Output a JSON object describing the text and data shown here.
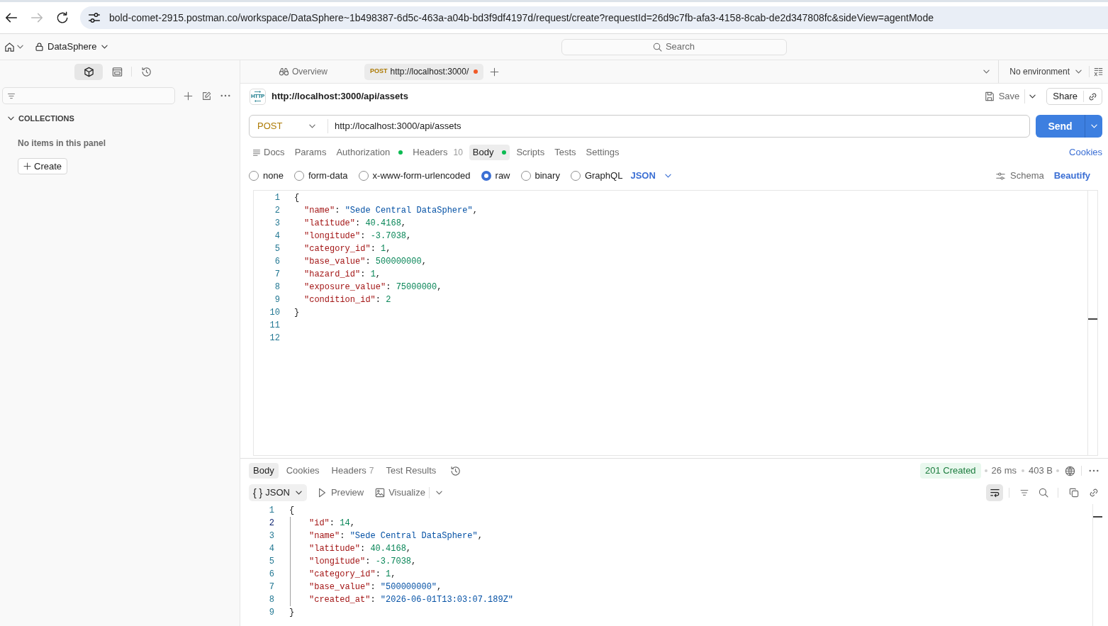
{
  "browser": {
    "back_enabled": true,
    "forward_enabled": false,
    "url": "bold-comet-2915.postman.co/workspace/DataSphere~1b498387-6d5c-463a-a04b-bd3f9df4197d/request/create?requestId=26d9c7fb-afa3-4158-8cab-de2d347808fc&sideView=agentMode"
  },
  "header": {
    "workspace": "DataSphere",
    "search": {
      "placeholder": "Search"
    }
  },
  "sidebar": {
    "views": [
      {
        "kind": "collections",
        "selected": true
      },
      {
        "kind": "panel",
        "selected": false
      },
      {
        "kind": "history",
        "selected": false
      }
    ],
    "section": {
      "title": "COLLECTIONS",
      "expanded": true
    },
    "empty_message": "No items in this panel",
    "create_button": "Create"
  },
  "tabs": [
    {
      "kind": "overview",
      "label": "Overview",
      "selected": false,
      "unsaved": false
    },
    {
      "kind": "request",
      "method": "POST",
      "label": "http://localhost:3000/",
      "selected": true,
      "unsaved": true
    }
  ],
  "environment": "No environment",
  "request": {
    "icon_label": "HTTP",
    "name": "http://localhost:3000/api/assets",
    "save_label": "Save",
    "share_label": "Share",
    "method": "POST",
    "url": "http://localhost:3000/api/assets",
    "send_label": "Send",
    "tabs": [
      {
        "kind": "docs",
        "label": "Docs",
        "dot": false,
        "selected": false
      },
      {
        "kind": "tab",
        "label": "Params",
        "dot": false,
        "selected": false
      },
      {
        "kind": "tab",
        "label": "Authorization",
        "dot": true,
        "selected": false
      },
      {
        "kind": "tab",
        "label": "Headers",
        "count": "10",
        "dot": false,
        "selected": false
      },
      {
        "kind": "tab",
        "label": "Body",
        "dot": true,
        "selected": true
      },
      {
        "kind": "tab",
        "label": "Scripts",
        "dot": false,
        "selected": false
      },
      {
        "kind": "tab",
        "label": "Tests",
        "dot": false,
        "selected": false
      },
      {
        "kind": "tab",
        "label": "Settings",
        "dot": false,
        "selected": false
      }
    ],
    "cookies_link": "Cookies",
    "body_modes": [
      {
        "label": "none",
        "selected": false
      },
      {
        "label": "form-data",
        "selected": false
      },
      {
        "label": "x-www-form-urlencoded",
        "selected": false
      },
      {
        "label": "raw",
        "selected": true
      },
      {
        "label": "binary",
        "selected": false
      },
      {
        "label": "GraphQL",
        "selected": false
      }
    ],
    "language": "JSON",
    "schema_label": "Schema",
    "beautify_label": "Beautify",
    "body_lines": [
      {
        "number": "1",
        "tokens": [
          {
            "kind": "punct",
            "text": "{"
          }
        ],
        "children": [
          {
            "number": "2",
            "tokens": [
              {
                "kind": "key",
                "text": "\"name\""
              },
              {
                "kind": "punct",
                "text": ": "
              },
              {
                "kind": "string",
                "text": "\"Sede Central DataSphere\""
              },
              {
                "kind": "punct",
                "text": ","
              }
            ]
          },
          {
            "number": "3",
            "tokens": [
              {
                "kind": "key",
                "text": "\"latitude\""
              },
              {
                "kind": "punct",
                "text": ": "
              },
              {
                "kind": "number",
                "text": "40.4168"
              },
              {
                "kind": "punct",
                "text": ","
              }
            ]
          },
          {
            "number": "4",
            "tokens": [
              {
                "kind": "key",
                "text": "\"longitude\""
              },
              {
                "kind": "punct",
                "text": ": "
              },
              {
                "kind": "number",
                "text": "-3.7038"
              },
              {
                "kind": "punct",
                "text": ","
              }
            ]
          },
          {
            "number": "5",
            "tokens": [
              {
                "kind": "key",
                "text": "\"category_id\""
              },
              {
                "kind": "punct",
                "text": ": "
              },
              {
                "kind": "number",
                "text": "1"
              },
              {
                "kind": "punct",
                "text": ","
              }
            ]
          },
          {
            "number": "6",
            "tokens": [
              {
                "kind": "key",
                "text": "\"base_value\""
              },
              {
                "kind": "punct",
                "text": ": "
              },
              {
                "kind": "number",
                "text": "500000000"
              },
              {
                "kind": "punct",
                "text": ","
              }
            ]
          },
          {
            "number": "7",
            "tokens": [
              {
                "kind": "key",
                "text": "\"hazard_id\""
              },
              {
                "kind": "punct",
                "text": ": "
              },
              {
                "kind": "number",
                "text": "1"
              },
              {
                "kind": "punct",
                "text": ","
              }
            ]
          },
          {
            "number": "8",
            "tokens": [
              {
                "kind": "key",
                "text": "\"exposure_value\""
              },
              {
                "kind": "punct",
                "text": ": "
              },
              {
                "kind": "number",
                "text": "75000000"
              },
              {
                "kind": "punct",
                "text": ","
              }
            ]
          },
          {
            "number": "9",
            "tokens": [
              {
                "kind": "key",
                "text": "\"condition_id\""
              },
              {
                "kind": "punct",
                "text": ": "
              },
              {
                "kind": "number",
                "text": "2"
              }
            ]
          }
        ]
      },
      {
        "number": "10",
        "tokens": [
          {
            "kind": "punct",
            "text": "}"
          }
        ]
      },
      {
        "number": "11"
      },
      {
        "number": "12"
      }
    ]
  },
  "response": {
    "tabs": [
      {
        "label": "Body",
        "selected": true
      },
      {
        "label": "Cookies",
        "selected": false
      },
      {
        "label": "Headers",
        "count": "7",
        "selected": false
      },
      {
        "label": "Test Results",
        "selected": false
      }
    ],
    "status": "201 Created",
    "time": "26 ms",
    "size": "403 B",
    "format": {
      "icon": "{ }",
      "label": "JSON"
    },
    "preview_label": "Preview",
    "visualize_label": "Visualize",
    "wrap_lines": true,
    "lines": [
      {
        "number": "1",
        "active": false,
        "tokens": [
          {
            "kind": "punct",
            "text": "{"
          }
        ],
        "children": [
          {
            "number": "2",
            "active": true,
            "tokens": [
              {
                "kind": "key",
                "text": "\"id\""
              },
              {
                "kind": "punct",
                "text": ": "
              },
              {
                "kind": "number",
                "text": "14"
              },
              {
                "kind": "punct",
                "text": ","
              }
            ]
          },
          {
            "number": "3",
            "active": false,
            "tokens": [
              {
                "kind": "key",
                "text": "\"name\""
              },
              {
                "kind": "punct",
                "text": ": "
              },
              {
                "kind": "string",
                "text": "\"Sede Central DataSphere\""
              },
              {
                "kind": "punct",
                "text": ","
              }
            ]
          },
          {
            "number": "4",
            "active": false,
            "tokens": [
              {
                "kind": "key",
                "text": "\"latitude\""
              },
              {
                "kind": "punct",
                "text": ": "
              },
              {
                "kind": "number",
                "text": "40.4168"
              },
              {
                "kind": "punct",
                "text": ","
              }
            ]
          },
          {
            "number": "5",
            "active": false,
            "tokens": [
              {
                "kind": "key",
                "text": "\"longitude\""
              },
              {
                "kind": "punct",
                "text": ": "
              },
              {
                "kind": "number",
                "text": "-3.7038"
              },
              {
                "kind": "punct",
                "text": ","
              }
            ]
          },
          {
            "number": "6",
            "active": false,
            "tokens": [
              {
                "kind": "key",
                "text": "\"category_id\""
              },
              {
                "kind": "punct",
                "text": ": "
              },
              {
                "kind": "number",
                "text": "1"
              },
              {
                "kind": "punct",
                "text": ","
              }
            ]
          },
          {
            "number": "7",
            "active": false,
            "tokens": [
              {
                "kind": "key",
                "text": "\"base_value\""
              },
              {
                "kind": "punct",
                "text": ": "
              },
              {
                "kind": "string",
                "text": "\"500000000\""
              },
              {
                "kind": "punct",
                "text": ","
              }
            ]
          },
          {
            "number": "8",
            "active": false,
            "tokens": [
              {
                "kind": "key",
                "text": "\"created_at\""
              },
              {
                "kind": "punct",
                "text": ": "
              },
              {
                "kind": "string",
                "text": "\"2026-06-01T13:03:07.189Z\""
              }
            ]
          }
        ]
      },
      {
        "number": "9",
        "active": false,
        "tokens": [
          {
            "kind": "punct",
            "text": "}"
          }
        ]
      }
    ]
  }
}
